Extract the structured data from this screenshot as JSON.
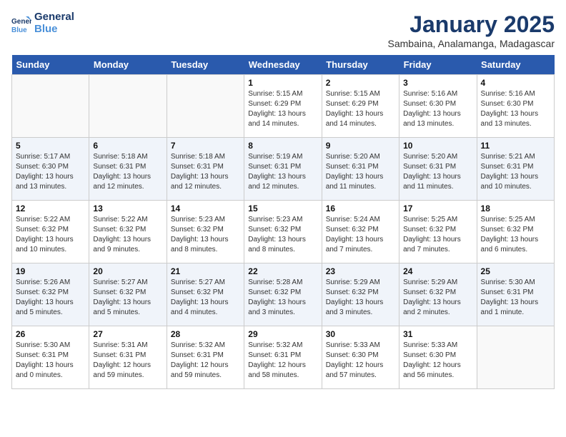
{
  "header": {
    "logo_line1": "General",
    "logo_line2": "Blue",
    "month_title": "January 2025",
    "location": "Sambaina, Analamanga, Madagascar"
  },
  "weekdays": [
    "Sunday",
    "Monday",
    "Tuesday",
    "Wednesday",
    "Thursday",
    "Friday",
    "Saturday"
  ],
  "weeks": [
    [
      {
        "day": "",
        "info": ""
      },
      {
        "day": "",
        "info": ""
      },
      {
        "day": "",
        "info": ""
      },
      {
        "day": "1",
        "info": "Sunrise: 5:15 AM\nSunset: 6:29 PM\nDaylight: 13 hours\nand 14 minutes."
      },
      {
        "day": "2",
        "info": "Sunrise: 5:15 AM\nSunset: 6:29 PM\nDaylight: 13 hours\nand 14 minutes."
      },
      {
        "day": "3",
        "info": "Sunrise: 5:16 AM\nSunset: 6:30 PM\nDaylight: 13 hours\nand 13 minutes."
      },
      {
        "day": "4",
        "info": "Sunrise: 5:16 AM\nSunset: 6:30 PM\nDaylight: 13 hours\nand 13 minutes."
      }
    ],
    [
      {
        "day": "5",
        "info": "Sunrise: 5:17 AM\nSunset: 6:30 PM\nDaylight: 13 hours\nand 13 minutes."
      },
      {
        "day": "6",
        "info": "Sunrise: 5:18 AM\nSunset: 6:31 PM\nDaylight: 13 hours\nand 12 minutes."
      },
      {
        "day": "7",
        "info": "Sunrise: 5:18 AM\nSunset: 6:31 PM\nDaylight: 13 hours\nand 12 minutes."
      },
      {
        "day": "8",
        "info": "Sunrise: 5:19 AM\nSunset: 6:31 PM\nDaylight: 13 hours\nand 12 minutes."
      },
      {
        "day": "9",
        "info": "Sunrise: 5:20 AM\nSunset: 6:31 PM\nDaylight: 13 hours\nand 11 minutes."
      },
      {
        "day": "10",
        "info": "Sunrise: 5:20 AM\nSunset: 6:31 PM\nDaylight: 13 hours\nand 11 minutes."
      },
      {
        "day": "11",
        "info": "Sunrise: 5:21 AM\nSunset: 6:31 PM\nDaylight: 13 hours\nand 10 minutes."
      }
    ],
    [
      {
        "day": "12",
        "info": "Sunrise: 5:22 AM\nSunset: 6:32 PM\nDaylight: 13 hours\nand 10 minutes."
      },
      {
        "day": "13",
        "info": "Sunrise: 5:22 AM\nSunset: 6:32 PM\nDaylight: 13 hours\nand 9 minutes."
      },
      {
        "day": "14",
        "info": "Sunrise: 5:23 AM\nSunset: 6:32 PM\nDaylight: 13 hours\nand 8 minutes."
      },
      {
        "day": "15",
        "info": "Sunrise: 5:23 AM\nSunset: 6:32 PM\nDaylight: 13 hours\nand 8 minutes."
      },
      {
        "day": "16",
        "info": "Sunrise: 5:24 AM\nSunset: 6:32 PM\nDaylight: 13 hours\nand 7 minutes."
      },
      {
        "day": "17",
        "info": "Sunrise: 5:25 AM\nSunset: 6:32 PM\nDaylight: 13 hours\nand 7 minutes."
      },
      {
        "day": "18",
        "info": "Sunrise: 5:25 AM\nSunset: 6:32 PM\nDaylight: 13 hours\nand 6 minutes."
      }
    ],
    [
      {
        "day": "19",
        "info": "Sunrise: 5:26 AM\nSunset: 6:32 PM\nDaylight: 13 hours\nand 5 minutes."
      },
      {
        "day": "20",
        "info": "Sunrise: 5:27 AM\nSunset: 6:32 PM\nDaylight: 13 hours\nand 5 minutes."
      },
      {
        "day": "21",
        "info": "Sunrise: 5:27 AM\nSunset: 6:32 PM\nDaylight: 13 hours\nand 4 minutes."
      },
      {
        "day": "22",
        "info": "Sunrise: 5:28 AM\nSunset: 6:32 PM\nDaylight: 13 hours\nand 3 minutes."
      },
      {
        "day": "23",
        "info": "Sunrise: 5:29 AM\nSunset: 6:32 PM\nDaylight: 13 hours\nand 3 minutes."
      },
      {
        "day": "24",
        "info": "Sunrise: 5:29 AM\nSunset: 6:32 PM\nDaylight: 13 hours\nand 2 minutes."
      },
      {
        "day": "25",
        "info": "Sunrise: 5:30 AM\nSunset: 6:31 PM\nDaylight: 13 hours\nand 1 minute."
      }
    ],
    [
      {
        "day": "26",
        "info": "Sunrise: 5:30 AM\nSunset: 6:31 PM\nDaylight: 13 hours\nand 0 minutes."
      },
      {
        "day": "27",
        "info": "Sunrise: 5:31 AM\nSunset: 6:31 PM\nDaylight: 12 hours\nand 59 minutes."
      },
      {
        "day": "28",
        "info": "Sunrise: 5:32 AM\nSunset: 6:31 PM\nDaylight: 12 hours\nand 59 minutes."
      },
      {
        "day": "29",
        "info": "Sunrise: 5:32 AM\nSunset: 6:31 PM\nDaylight: 12 hours\nand 58 minutes."
      },
      {
        "day": "30",
        "info": "Sunrise: 5:33 AM\nSunset: 6:30 PM\nDaylight: 12 hours\nand 57 minutes."
      },
      {
        "day": "31",
        "info": "Sunrise: 5:33 AM\nSunset: 6:30 PM\nDaylight: 12 hours\nand 56 minutes."
      },
      {
        "day": "",
        "info": ""
      }
    ]
  ]
}
